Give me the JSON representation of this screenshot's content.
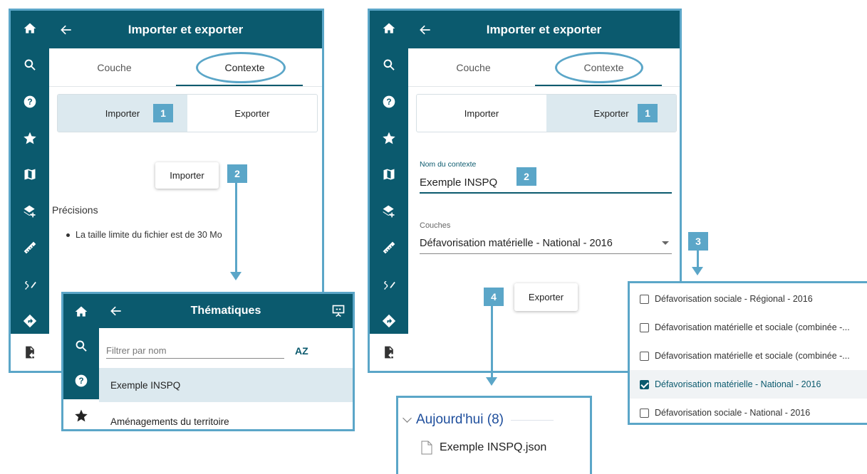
{
  "colors": {
    "sidebar": "#0b5a6e",
    "accent": "#5ba6c8",
    "selected": "#dce9ef"
  },
  "left_panel": {
    "title": "Importer et exporter",
    "tab_layer": "Couche",
    "tab_context": "Contexte",
    "toggle_import": "Importer",
    "toggle_export": "Exporter",
    "badge1": "1",
    "import_button": "Importer",
    "badge2": "2",
    "precisions": "Précisions",
    "bullet": "La taille limite du fichier est de 30 Mo"
  },
  "themes_panel": {
    "title": "Thématiques",
    "filter_placeholder": "Filtrer par nom",
    "sort_icon": "AZ",
    "item_selected": "Exemple INSPQ",
    "item_2": "Aménagements du territoire"
  },
  "right_panel": {
    "title": "Importer et exporter",
    "tab_layer": "Couche",
    "tab_context": "Contexte",
    "toggle_import": "Importer",
    "toggle_export": "Exporter",
    "badge1": "1",
    "context_name_label": "Nom du contexte",
    "context_name_value": "Exemple INSPQ",
    "badge2": "2",
    "layers_label": "Couches",
    "layers_value": "Défavorisation matérielle - National - 2016",
    "export_button": "Exporter",
    "badge3": "3",
    "badge4": "4"
  },
  "dropdown": {
    "items": [
      {
        "label": "Défavorisation sociale - Régional - 2016",
        "checked": false
      },
      {
        "label": "Défavorisation matérielle et sociale (combinée -...",
        "checked": false
      },
      {
        "label": "Défavorisation matérielle et sociale (combinée -...",
        "checked": false
      },
      {
        "label": "Défavorisation matérielle - National - 2016",
        "checked": true
      },
      {
        "label": "Défavorisation sociale - National - 2016",
        "checked": false
      }
    ]
  },
  "explorer": {
    "group_label": "Aujourd'hui (8)",
    "file_name": "Exemple INSPQ.json"
  }
}
